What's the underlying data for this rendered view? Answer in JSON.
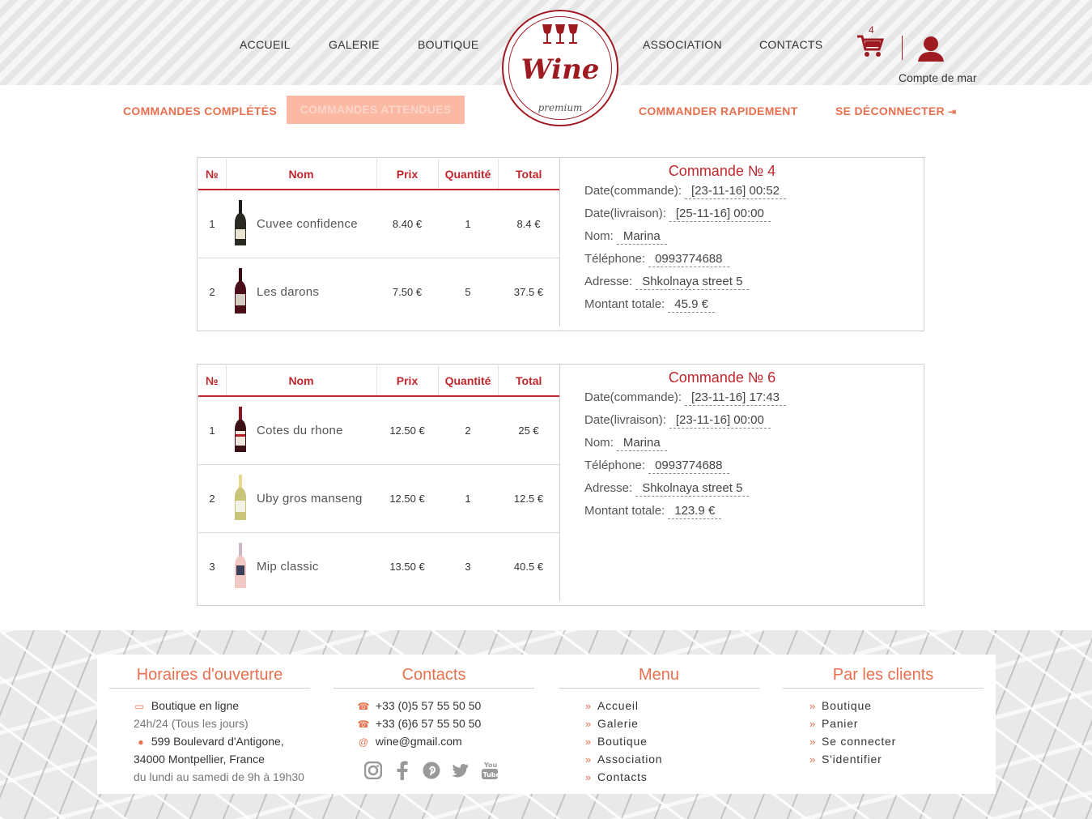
{
  "nav": {
    "left": [
      "ACCUEIL",
      "GALERIE",
      "BOUTIQUE"
    ],
    "right": [
      "ASSOCIATION",
      "CONTACTS"
    ]
  },
  "logo": {
    "word": "Wine",
    "sub": "premium"
  },
  "cart": {
    "count": "4"
  },
  "account": {
    "label": "Compte de mar"
  },
  "subnav": {
    "completed": "COMMANDES COMPLÉTÉS",
    "pending": "COMMANDES ATTENDUES",
    "quick": "COMMANDER RAPIDEMENT",
    "logout": "SE DÉCONNECTER"
  },
  "table_headers": [
    "№",
    "Nom",
    "Prix",
    "Quantité",
    "Total"
  ],
  "orders": [
    {
      "title": "Commande № 4",
      "items": [
        {
          "num": "1",
          "name": "Cuvee confidence",
          "price": "8.40 €",
          "qty": "1",
          "total": "8.4 €"
        },
        {
          "num": "2",
          "name": "Les darons",
          "price": "7.50 €",
          "qty": "5",
          "total": "37.5 €"
        }
      ],
      "info": {
        "date_cmd_label": "Date(commande):",
        "date_cmd": "[23-11-16] 00:52",
        "date_liv_label": "Date(livraison):",
        "date_liv": "[25-11-16] 00:00",
        "nom_label": "Nom:",
        "nom": "Marina",
        "tel_label": "Téléphone:",
        "tel": "0993774688",
        "adresse_label": "Adresse:",
        "adresse": "Shkolnaya street 5",
        "montant_label": "Montant totale:",
        "montant": "45.9 €"
      }
    },
    {
      "title": "Commande № 6",
      "items": [
        {
          "num": "1",
          "name": "Cotes du rhone",
          "price": "12.50 €",
          "qty": "2",
          "total": "25 €"
        },
        {
          "num": "2",
          "name": "Uby gros manseng",
          "price": "12.50 €",
          "qty": "1",
          "total": "12.5 €"
        },
        {
          "num": "3",
          "name": "Mip classic",
          "price": "13.50 €",
          "qty": "3",
          "total": "40.5 €"
        }
      ],
      "info": {
        "date_cmd_label": "Date(commande):",
        "date_cmd": "[23-11-16] 17:43",
        "date_liv_label": "Date(livraison):",
        "date_liv": "[23-11-16] 00:00",
        "nom_label": "Nom:",
        "nom": "Marina",
        "tel_label": "Téléphone:",
        "tel": "0993774688",
        "adresse_label": "Adresse:",
        "adresse": "Shkolnaya street 5",
        "montant_label": "Montant totale:",
        "montant": "123.9 €"
      }
    }
  ],
  "footer": {
    "hours": {
      "title": "Horaires d'ouverture",
      "online": "Boutique en ligne",
      "online_hours": "24h/24 (Tous les jours)",
      "address1": "599 Boulevard d'Antigone,",
      "address2": "34000 Montpellier, France",
      "schedule": "du lundi au samedi de 9h à 19h30"
    },
    "contacts": {
      "title": "Contacts",
      "phone1": "+33 (0)5 57 55 50 50",
      "phone2": "+33 (6)6 57 55 50 50",
      "email": "wine@gmail.com",
      "socials": [
        "instagram-icon",
        "facebook-icon",
        "pinterest-icon",
        "twitter-icon",
        "youtube-icon"
      ]
    },
    "menu": {
      "title": "Menu",
      "items": [
        "Accueil",
        "Galerie",
        "Boutique",
        "Association",
        "Contacts"
      ]
    },
    "clients": {
      "title": "Par les clients",
      "items": [
        "Boutique",
        "Panier",
        "Se connecter",
        "S'identifier"
      ]
    }
  },
  "colors": {
    "accent": "#e8704e",
    "brand": "#9e1b22",
    "table_red": "#c0272d",
    "active_tab_bg": "#fbb9a4"
  }
}
